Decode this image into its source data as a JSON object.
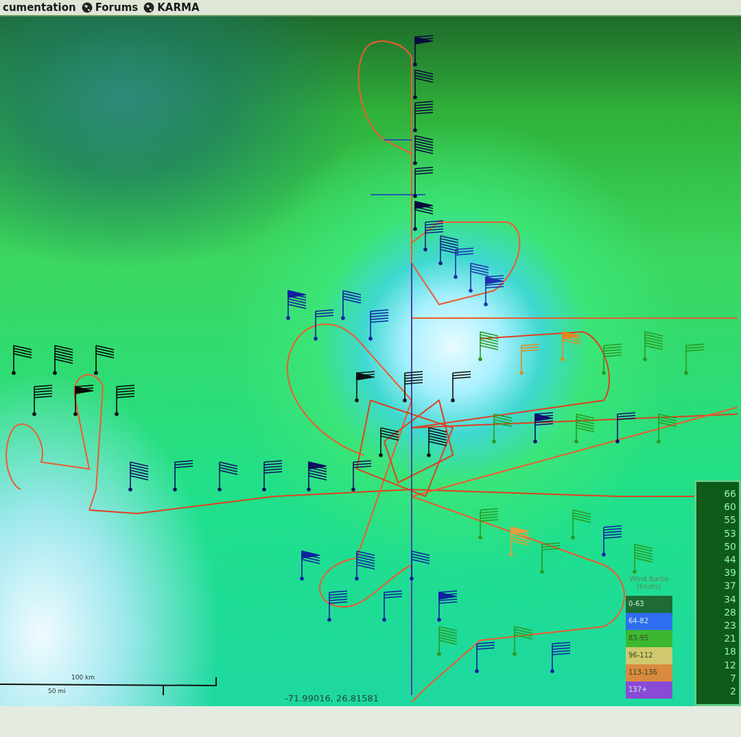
{
  "top_menu": [
    {
      "label": "cumentation",
      "icon": false
    },
    {
      "label": "Forums",
      "icon": true
    },
    {
      "label": "KARMA",
      "icon": true
    }
  ],
  "map": {
    "legend": {
      "title": "Wind Barbs",
      "subtitle": "(knots)",
      "items": [
        {
          "label": "0-63",
          "color": "#1e6b35"
        },
        {
          "label": "64-82",
          "color": "#2f6df0"
        },
        {
          "label": "83-95",
          "color": "#3cb830"
        },
        {
          "label": "96-112",
          "color": "#cfc86e"
        },
        {
          "label": "113-136",
          "color": "#d98a3e"
        },
        {
          "label": "137+",
          "color": "#8a4ad8"
        }
      ]
    },
    "color_scale": {
      "labels": [
        "66",
        "60",
        "55",
        "53",
        "50",
        "44",
        "39",
        "37",
        "34",
        "28",
        "23",
        "21",
        "18",
        "12",
        "7",
        "2"
      ]
    },
    "scale_bar": {
      "km_label": "100 km",
      "mi_label": "50 mi"
    },
    "coordinates": "-71.99016, 26.81581"
  }
}
